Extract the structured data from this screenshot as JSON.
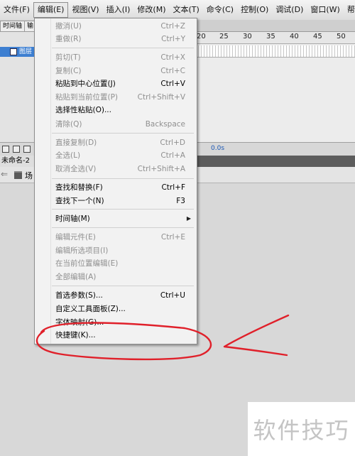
{
  "menubar": {
    "items": [
      "文件(F)",
      "编辑(E)",
      "视图(V)",
      "插入(I)",
      "修改(M)",
      "文本(T)",
      "命令(C)",
      "控制(O)",
      "调试(D)",
      "窗口(W)",
      "帮助"
    ]
  },
  "timeline": {
    "tabs": [
      "时间轴",
      "输"
    ],
    "layer_name": "图层",
    "ruler_ticks": [
      "20",
      "25",
      "30",
      "35",
      "40",
      "45",
      "50"
    ],
    "elapsed": "0.0s"
  },
  "document": {
    "tab_title": "未命名-2",
    "tab_close": "×",
    "scene_label": "场"
  },
  "edit_menu": {
    "items": [
      {
        "label": "撤消(U)",
        "shortcut": "Ctrl+Z",
        "enabled": false
      },
      {
        "label": "重做(R)",
        "shortcut": "Ctrl+Y",
        "enabled": false
      },
      {
        "label": "剪切(T)",
        "shortcut": "Ctrl+X",
        "enabled": false
      },
      {
        "label": "复制(C)",
        "shortcut": "Ctrl+C",
        "enabled": false
      },
      {
        "label": "粘贴到中心位置(J)",
        "shortcut": "Ctrl+V",
        "enabled": true
      },
      {
        "label": "粘贴到当前位置(P)",
        "shortcut": "Ctrl+Shift+V",
        "enabled": false
      },
      {
        "label": "选择性粘贴(O)...",
        "shortcut": "",
        "enabled": true
      },
      {
        "label": "清除(Q)",
        "shortcut": "Backspace",
        "enabled": false
      },
      {
        "label": "直接复制(D)",
        "shortcut": "Ctrl+D",
        "enabled": false
      },
      {
        "label": "全选(L)",
        "shortcut": "Ctrl+A",
        "enabled": false
      },
      {
        "label": "取消全选(V)",
        "shortcut": "Ctrl+Shift+A",
        "enabled": false
      },
      {
        "label": "查找和替换(F)",
        "shortcut": "Ctrl+F",
        "enabled": true
      },
      {
        "label": "查找下一个(N)",
        "shortcut": "F3",
        "enabled": true
      },
      {
        "label": "时间轴(M)",
        "shortcut": "",
        "enabled": true
      },
      {
        "label": "编辑元件(E)",
        "shortcut": "Ctrl+E",
        "enabled": false
      },
      {
        "label": "编辑所选项目(I)",
        "shortcut": "",
        "enabled": false
      },
      {
        "label": "在当前位置编辑(E)",
        "shortcut": "",
        "enabled": false
      },
      {
        "label": "全部编辑(A)",
        "shortcut": "",
        "enabled": false
      },
      {
        "label": "首选参数(S)...",
        "shortcut": "Ctrl+U",
        "enabled": true
      },
      {
        "label": "自定义工具面板(Z)...",
        "shortcut": "",
        "enabled": true
      },
      {
        "label": "字体映射(G)...",
        "shortcut": "",
        "enabled": true
      },
      {
        "label": "快捷键(K)...",
        "shortcut": "",
        "enabled": true
      }
    ]
  },
  "watermark": "软件技巧",
  "colors": {
    "menu_bg": "#f2f2f2",
    "disabled_text": "#8f8f8f",
    "selected_layer": "#3d7fd1",
    "annotation": "#e0202a"
  }
}
